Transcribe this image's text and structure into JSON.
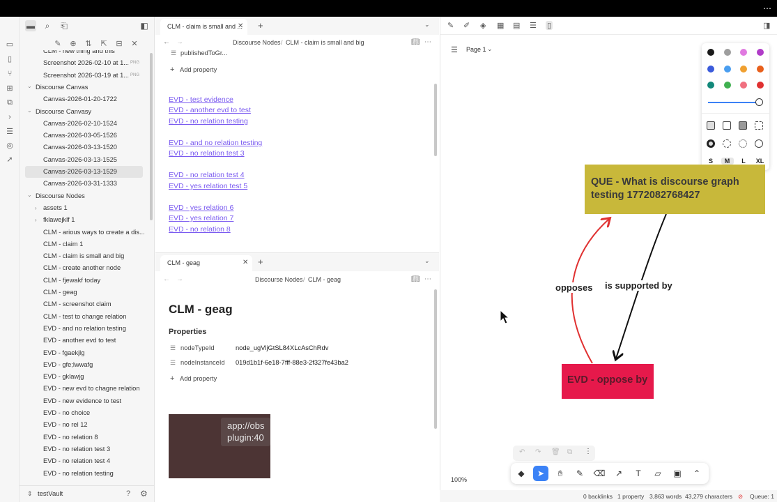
{
  "sidebar": {
    "tree": [
      {
        "label": "CLM - new thing and this",
        "level": 2
      },
      {
        "label": "Screenshot 2026-02-10 at 1...",
        "level": 2,
        "badge": "PNG"
      },
      {
        "label": "Screenshot 2026-03-19 at 1...",
        "level": 2,
        "badge": "PNG"
      },
      {
        "label": "Discourse Canvas",
        "level": 1,
        "folder": true
      },
      {
        "label": "Canvas-2026-01-20-1722",
        "level": 2
      },
      {
        "label": "Discourse Canvasy",
        "level": 1,
        "folder": true
      },
      {
        "label": "Canvas-2026-02-10-1524",
        "level": 2
      },
      {
        "label": "Canvas-2026-03-05-1526",
        "level": 2
      },
      {
        "label": "Canvas-2026-03-13-1520",
        "level": 2
      },
      {
        "label": "Canvas-2026-03-13-1525",
        "level": 2
      },
      {
        "label": "Canvas-2026-03-13-1529",
        "level": 2,
        "selected": true
      },
      {
        "label": "Canvas-2026-03-31-1333",
        "level": 2
      },
      {
        "label": "Discourse Nodes",
        "level": 1,
        "folder": true
      },
      {
        "label": "assets 1",
        "level": 2,
        "collapsed": true
      },
      {
        "label": "fklawejklf 1",
        "level": 2,
        "collapsed": true
      },
      {
        "label": "CLM - arious ways to create a dis...",
        "level": 2
      },
      {
        "label": "CLM - claim 1",
        "level": 2
      },
      {
        "label": "CLM - claim is small and big",
        "level": 2
      },
      {
        "label": "CLM - create another node",
        "level": 2
      },
      {
        "label": "CLM - fjewakf today",
        "level": 2
      },
      {
        "label": "CLM - geag",
        "level": 2
      },
      {
        "label": "CLM - screenshot claim",
        "level": 2
      },
      {
        "label": "CLM - test to change relation",
        "level": 2
      },
      {
        "label": "EVD - and no relation testing",
        "level": 2
      },
      {
        "label": "EVD - another evd to test",
        "level": 2
      },
      {
        "label": "EVD - fgaekjlg",
        "level": 2
      },
      {
        "label": "EVD - gfe;lwwafg",
        "level": 2
      },
      {
        "label": "EVD - gklawjg",
        "level": 2
      },
      {
        "label": "EVD - new evd to chagne relation",
        "level": 2
      },
      {
        "label": "EVD - new evidence to test",
        "level": 2
      },
      {
        "label": "EVD - no choice",
        "level": 2
      },
      {
        "label": "EVD - no rel 12",
        "level": 2
      },
      {
        "label": "EVD - no relation 8",
        "level": 2
      },
      {
        "label": "EVD - no relation test 3",
        "level": 2
      },
      {
        "label": "EVD - no relation test 4",
        "level": 2
      },
      {
        "label": "EVD - no relation testing",
        "level": 2
      }
    ],
    "vault_name": "testVault"
  },
  "pane_top": {
    "tab_title": "CLM - claim is small and ...",
    "breadcrumb_parent": "Discourse Nodes",
    "breadcrumb_sep": "/",
    "breadcrumb_current": "CLM - claim is small and big",
    "partial_property": "publishedToGr...",
    "add_property": "Add property",
    "links": [
      "EVD - test evidence",
      "EVD - another evd to test",
      "EVD - no relation testing",
      "EVD - and no relation testing",
      "EVD - no relation test 3",
      "EVD - no relation test 4",
      "EVD - yes relation test 5",
      "EVD - yes relation 6",
      "EVD - yes relation 7",
      "EVD - no relation 8"
    ]
  },
  "pane_bottom": {
    "tab_title": "CLM - geag",
    "breadcrumb_parent": "Discourse Nodes",
    "breadcrumb_sep": "/",
    "breadcrumb_current": "CLM - geag",
    "heading": "CLM - geag",
    "properties_heading": "Properties",
    "props": [
      {
        "key": "nodeTypeId",
        "value": "node_ugVljGtSL84XLcAsChRdv"
      },
      {
        "key": "nodeInstanceId",
        "value": "019d1b1f-6e18-7fff-88e3-2f327fe43ba2"
      }
    ],
    "add_property": "Add property",
    "image_text_line1": "app://obs",
    "image_text_line2": "plugin:40"
  },
  "canvas": {
    "page_label": "Page 1",
    "que_node": "QUE - What is discourse graph testing 1772082768427",
    "evd_node": "EVD - oppose by",
    "edge_opposes": "opposes",
    "edge_supported": "is supported by",
    "zoom": "100%",
    "colors": [
      "#1a1a1a",
      "#9e9e9e",
      "#e07ae0",
      "#b03cc8",
      "#3b5bdb",
      "#4a9ef0",
      "#f0a030",
      "#e8601c",
      "#12887a",
      "#40b050",
      "#f07080",
      "#e03131"
    ],
    "sizes": [
      "S",
      "M",
      "L",
      "XL"
    ],
    "selected_size": "M",
    "que_color": "#c8b83a",
    "evd_color": "#e6194b"
  },
  "status": {
    "backlinks": "0 backlinks",
    "properties": "1 property",
    "words": "3,863 words",
    "characters": "43,279 characters",
    "queue": "Queue: 1"
  }
}
